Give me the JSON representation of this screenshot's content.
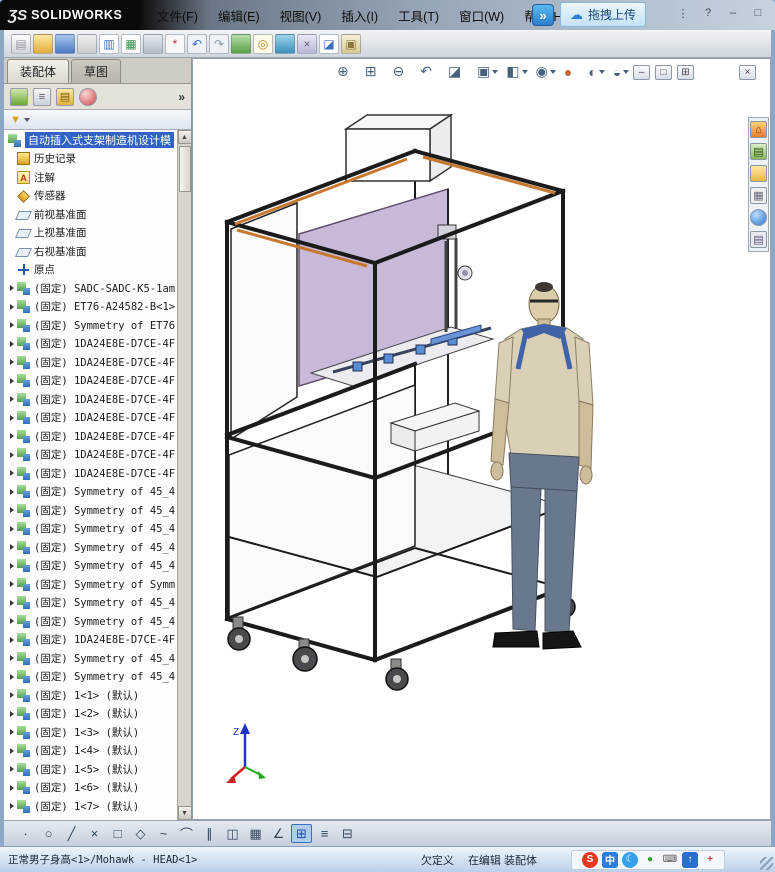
{
  "colors": {
    "selection_blue": "#3163c6",
    "panel_purple": "#c9b9d9",
    "frame_orange": "#c8782e",
    "shirt_khaki": "#d9d0b6",
    "pants_blue_gray": "#6a788e"
  },
  "titlebar": {
    "logo_mark": "ƷS",
    "logo_text": "SOLIDWORKS",
    "menus": [
      "文件(F)",
      "编辑(E)",
      "视图(V)",
      "插入(I)",
      "工具(T)",
      "窗口(W)",
      "帮助(H)"
    ],
    "share_icon_glyph": "»",
    "upload_icon_glyph": "☁",
    "upload_button": "拖拽上传",
    "window_icons": [
      {
        "name": "more-options-icon",
        "glyph": "⋮"
      },
      {
        "name": "help-icon",
        "glyph": "?"
      },
      {
        "name": "minimize-window-icon",
        "glyph": "–"
      },
      {
        "name": "restore-window-icon",
        "glyph": "□"
      }
    ]
  },
  "main_toolbar": {
    "icons": [
      {
        "name": "new-document-icon",
        "glyph": "▤",
        "fg": "#99a",
        "bg": "linear-gradient(#ffffff,#d0d4d8)"
      },
      {
        "name": "open-document-icon",
        "bg": "linear-gradient(#ffeaa0,#e2aa3c)"
      },
      {
        "name": "save-icon",
        "bg": "linear-gradient(#a8c6ee,#4a78c4)"
      },
      {
        "name": "attachment-icon",
        "bg": "linear-gradient(#f0f0f0,#c8ccd0)"
      },
      {
        "name": "make-drawing-icon",
        "glyph": "▥",
        "fg": "#3a6fc0",
        "bg": "#ffffff"
      },
      {
        "name": "make-assembly-icon",
        "glyph": "▦",
        "fg": "#3a8f50",
        "bg": "#ffffff"
      },
      {
        "name": "print-icon",
        "bg": "linear-gradient(#e8ecf0,#b0bac4)"
      },
      {
        "name": "rebuild-icon",
        "glyph": "*",
        "fg": "#c03030",
        "bg": "#f8f8f8"
      },
      {
        "name": "undo-icon",
        "glyph": "↶",
        "fg": "#3a6fc0",
        "bg": "#eef2f6"
      },
      {
        "name": "redo-icon",
        "glyph": "↷",
        "fg": "#8899aa",
        "bg": "#eef2f6"
      },
      {
        "name": "insert-component-icon",
        "bg": "linear-gradient(#b8e0a8,#58a048)"
      },
      {
        "name": "mate-icon",
        "glyph": "◎",
        "fg": "#c08020",
        "bg": "#fffbe8"
      },
      {
        "name": "exploded-view-icon",
        "bg": "linear-gradient(#9fd4ec,#3a90b8)"
      },
      {
        "name": "interference-check-icon",
        "glyph": "×",
        "fg": "#667",
        "bg": "linear-gradient(#e8e8f8,#b8b8d8)"
      },
      {
        "name": "section-tool-icon",
        "glyph": "◪",
        "fg": "#3a6fc0",
        "bg": "#ffffff"
      },
      {
        "name": "screenshot-icon",
        "glyph": "▣",
        "fg": "#8a7a40",
        "bg": "linear-gradient(#f8f0d8,#d8c890)"
      }
    ]
  },
  "tabs": [
    {
      "name": "tab-assembly",
      "label": "装配体",
      "cls": "active"
    },
    {
      "name": "tab-sketch",
      "label": "草图"
    }
  ],
  "panel": {
    "header_icons": [
      {
        "name": "feature-manager-tree-icon",
        "bg": "linear-gradient(#cfe8a8,#6aa83a)"
      },
      {
        "name": "property-manager-icon",
        "glyph": "≡",
        "bg": "linear-gradient(#fafafa,#c8d0d8)"
      },
      {
        "name": "configuration-manager-icon",
        "glyph": "▤",
        "fg": "#7a5a10",
        "bg": "linear-gradient(#ffe9a8,#e0b040)"
      },
      {
        "name": "display-manager-icon",
        "cls": "round",
        "bg": "radial-gradient(circle at 35% 30%,#ffd8d8,#cc4444)"
      }
    ],
    "overflow_glyph": "»",
    "filter": {
      "glyph": "▼"
    }
  },
  "tree": {
    "root": {
      "label": "自动插入式支架制造机设计模",
      "icon": "asm"
    },
    "items": [
      {
        "label": "历史记录",
        "icon": "history",
        "arrow": false
      },
      {
        "label": "注解",
        "icon": "ann",
        "glyph": "A",
        "arrow": false
      },
      {
        "label": "传感器",
        "icon": "sensor",
        "arrow": false
      },
      {
        "label": "前视基准面",
        "icon": "plane",
        "arrow": false
      },
      {
        "label": "上视基准面",
        "icon": "plane",
        "arrow": false
      },
      {
        "label": "右视基准面",
        "icon": "plane",
        "arrow": false
      },
      {
        "label": "原点",
        "icon": "origin",
        "arrow": false
      },
      {
        "label": "(固定) SADC-SADC-K5-1am",
        "icon": "asm",
        "arrow": true
      },
      {
        "label": "(固定) ET76-A24582-B<1>",
        "icon": "asm",
        "arrow": true
      },
      {
        "label": "(固定) Symmetry of ET76",
        "icon": "asm",
        "arrow": true
      },
      {
        "label": "(固定) 1DA24E8E-D7CE-4F",
        "icon": "asm",
        "arrow": true
      },
      {
        "label": "(固定) 1DA24E8E-D7CE-4F",
        "icon": "asm",
        "arrow": true
      },
      {
        "label": "(固定) 1DA24E8E-D7CE-4F",
        "icon": "asm",
        "arrow": true
      },
      {
        "label": "(固定) 1DA24E8E-D7CE-4F",
        "icon": "asm",
        "arrow": true
      },
      {
        "label": "(固定) 1DA24E8E-D7CE-4F",
        "icon": "asm",
        "arrow": true
      },
      {
        "label": "(固定) 1DA24E8E-D7CE-4F",
        "icon": "asm",
        "arrow": true
      },
      {
        "label": "(固定) 1DA24E8E-D7CE-4F",
        "icon": "asm",
        "arrow": true
      },
      {
        "label": "(固定) 1DA24E8E-D7CE-4F",
        "icon": "asm",
        "arrow": true
      },
      {
        "label": "(固定) Symmetry of 45_4",
        "icon": "asm",
        "arrow": true
      },
      {
        "label": "(固定) Symmetry of 45_4",
        "icon": "asm",
        "arrow": true
      },
      {
        "label": "(固定) Symmetry of 45_4",
        "icon": "asm",
        "arrow": true
      },
      {
        "label": "(固定) Symmetry of 45_4",
        "icon": "asm",
        "arrow": true
      },
      {
        "label": "(固定) Symmetry of 45_4",
        "icon": "asm",
        "arrow": true
      },
      {
        "label": "(固定) Symmetry of Symm",
        "icon": "asm",
        "arrow": true
      },
      {
        "label": "(固定) Symmetry of 45_4",
        "icon": "asm",
        "arrow": true
      },
      {
        "label": "(固定) Symmetry of 45_4",
        "icon": "asm",
        "arrow": true
      },
      {
        "label": "(固定) 1DA24E8E-D7CE-4F",
        "icon": "asm",
        "arrow": true
      },
      {
        "label": "(固定) Symmetry of 45_4",
        "icon": "asm",
        "arrow": true
      },
      {
        "label": "(固定) Symmetry of 45_4",
        "icon": "asm",
        "arrow": true
      },
      {
        "label": "(固定) 1<1> (默认)",
        "icon": "asm",
        "arrow": true
      },
      {
        "label": "(固定) 1<2> (默认)",
        "icon": "asm",
        "arrow": true
      },
      {
        "label": "(固定) 1<3> (默认)",
        "icon": "asm",
        "arrow": true
      },
      {
        "label": "(固定) 1<4> (默认)",
        "icon": "asm",
        "arrow": true
      },
      {
        "label": "(固定) 1<5> (默认)",
        "icon": "asm",
        "arrow": true
      },
      {
        "label": "(固定) 1<6> (默认)",
        "icon": "asm",
        "arrow": true
      },
      {
        "label": "(固定) 1<7> (默认)",
        "icon": "asm",
        "arrow": true
      }
    ]
  },
  "viewport": {
    "hud_icons": [
      {
        "name": "zoom-fit-icon",
        "glyph": "⊕"
      },
      {
        "name": "zoom-area-icon",
        "glyph": "⊞"
      },
      {
        "name": "zoom-in-out-icon",
        "glyph": "⊖"
      },
      {
        "name": "previous-view-icon",
        "glyph": "↶"
      },
      {
        "name": "section-view-icon",
        "glyph": "◪"
      },
      {
        "name": "view-orientation-icon",
        "glyph": "▣",
        "caret": true
      },
      {
        "name": "display-style-icon",
        "glyph": "◧",
        "caret": true
      },
      {
        "name": "hide-show-items-icon",
        "glyph": "◉",
        "caret": true
      },
      {
        "name": "edit-appearance-icon",
        "glyph": "●",
        "fg": "#c86830"
      },
      {
        "name": "apply-scene-icon",
        "glyph": "◐",
        "caret": true
      },
      {
        "name": "view-settings-icon",
        "glyph": "◒",
        "caret": true
      }
    ],
    "doc_window_icons": [
      {
        "name": "doc-minimize-icon",
        "glyph": "–"
      },
      {
        "name": "doc-restore-icon",
        "glyph": "□"
      },
      {
        "name": "doc-tile-icon",
        "glyph": "⊞"
      },
      {
        "name": "doc-close-icon",
        "glyph": "×",
        "cls": "gap"
      }
    ],
    "task_pane_icons": [
      {
        "name": "solidworks-resources-icon",
        "glyph": "⌂",
        "fg": "#803000",
        "bg": "linear-gradient(#ffd080,#e08030)"
      },
      {
        "name": "design-library-icon",
        "glyph": "▤",
        "fg": "#305010",
        "bg": "linear-gradient(#d8eec8,#88b858)"
      },
      {
        "name": "file-explorer-icon",
        "bg": "linear-gradient(#ffe8a0,#e8b848)"
      },
      {
        "name": "view-palette-icon",
        "glyph": "▦",
        "fg": "#667",
        "bg": "#f0f0f0"
      },
      {
        "name": "appearances-icon",
        "cls": "round",
        "bg": "radial-gradient(circle at 35% 30%,#b8e0ff,#2a70c8)"
      },
      {
        "name": "custom-properties-icon",
        "glyph": "▤",
        "fg": "#557",
        "bg": "#e8e8f0"
      }
    ],
    "triad": {
      "z_label": "Z"
    }
  },
  "sketch_toolbar": {
    "icons": [
      {
        "name": "select-tool-icon",
        "glyph": "·"
      },
      {
        "name": "circle-tool-icon",
        "glyph": "○"
      },
      {
        "name": "line-tool-icon",
        "glyph": "╱"
      },
      {
        "name": "erase-tool-icon",
        "glyph": "×"
      },
      {
        "name": "rectangle-tool-icon",
        "glyph": "□"
      },
      {
        "name": "polygon-tool-icon",
        "glyph": "◇"
      },
      {
        "name": "spline-tool-icon",
        "glyph": "~"
      },
      {
        "name": "arc-tool-icon",
        "glyph": "⌒"
      },
      {
        "name": "offset-tool-icon",
        "glyph": "∥"
      },
      {
        "name": "mirror-tool-icon",
        "glyph": "◫"
      },
      {
        "name": "linear-pattern-icon",
        "glyph": "▦"
      },
      {
        "name": "angle-dimension-icon",
        "glyph": "∠"
      },
      {
        "name": "grid-system-button",
        "glyph": "⊞",
        "cls": "active"
      },
      {
        "name": "evaluate-button",
        "glyph": "≡"
      },
      {
        "name": "options-button",
        "glyph": "⊟"
      }
    ]
  },
  "statusbar": {
    "selection": "正常男子身高<1>/Mohawk - HEAD<1>",
    "state": "欠定义",
    "mode": "在编辑 装配体",
    "tray": [
      {
        "name": "sogou-input-icon",
        "glyph": "S",
        "fg": "#fff",
        "bg": "#e83820",
        "cls": "round"
      },
      {
        "name": "chinese-mode-icon",
        "glyph": "中",
        "fg": "#fff",
        "bg": "#2a7de0"
      },
      {
        "name": "half-width-icon",
        "glyph": "☾",
        "fg": "#fff",
        "bg": "#38a0e8",
        "cls": "round"
      },
      {
        "name": "status-ok-icon",
        "glyph": "●",
        "fg": "#2aa02a"
      },
      {
        "name": "keyboard-icon",
        "glyph": "⌨",
        "fg": "#555"
      },
      {
        "name": "upload-tray-icon",
        "glyph": "↑",
        "fg": "#fff",
        "bg": "#2a6fd0"
      },
      {
        "name": "toolbox-icon",
        "glyph": "+",
        "fg": "#c04040"
      }
    ]
  }
}
